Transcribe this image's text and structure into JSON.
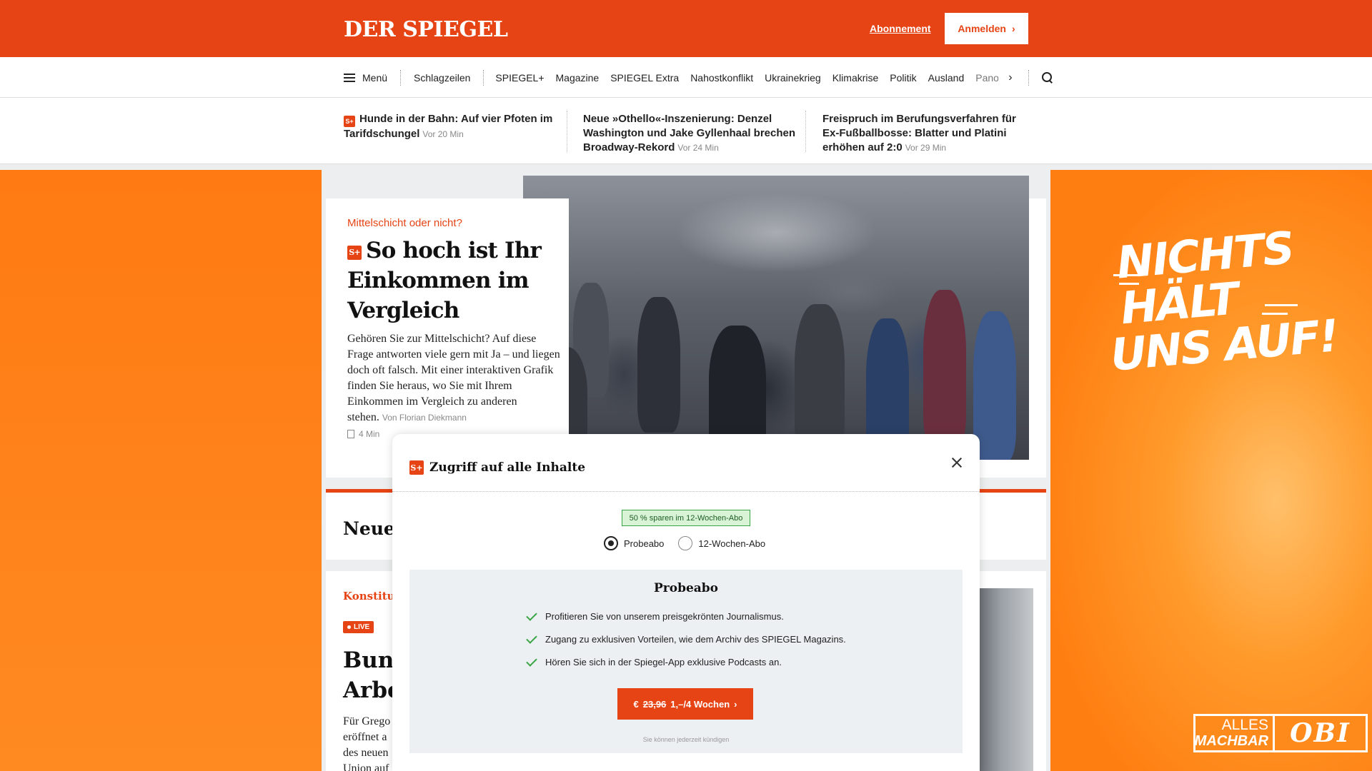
{
  "header": {
    "logo": "DER SPIEGEL",
    "subscription_link": "Abonnement",
    "login_button": "Anmelden",
    "chevron": "›"
  },
  "nav": {
    "menu_label": "Menü",
    "items": [
      "Schlagzeilen",
      "SPIEGEL+",
      "Magazine",
      "SPIEGEL Extra",
      "Nahostkonflikt",
      "Ukrainekrieg",
      "Klimakrise",
      "Politik",
      "Ausland"
    ],
    "overflow_item": "Panora",
    "next_arrow": "›"
  },
  "ticker": [
    {
      "badge": "S+",
      "title": "Hunde in der Bahn: Auf vier Pfoten im Tarifdschungel",
      "time": "Vor 20 Min"
    },
    {
      "badge": "",
      "title": "Neue »Othello«-Inszenierung: Denzel Washington und Jake Gyllenhaal brechen Broadway-Rekord",
      "time": "Vor 24 Min"
    },
    {
      "badge": "",
      "title": "Freispruch im Berufungsverfahren für Ex-Fußballbosse: Blatter und Platini erhöhen auf 2:0",
      "time": "Vor 29 Min"
    }
  ],
  "hero": {
    "kicker": "Mittelschicht oder nicht?",
    "badge": "S+",
    "headline": "So hoch ist Ihr Einkommen im Vergleich",
    "teaser": "Gehören Sie zur Mittelschicht? Auf diese Frage antworten viele gern mit Ja – und liegen doch oft falsch. Mit einer interaktiven Grafik finden Sie heraus, wo Sie mit Ihrem Einkommen im Vergleich zu anderen stehen.",
    "author": "Von Florian Diekmann",
    "read_time": "4 Min"
  },
  "section": {
    "title": "Neuer"
  },
  "news": {
    "kicker": "Konstitu",
    "live_label": "LIVE",
    "title_line1": "Bund",
    "title_line2": "Arbe",
    "teaser_lines": [
      "Für Grego",
      "eröffnet a",
      "des neuen",
      "Union auf"
    ]
  },
  "ad": {
    "slogan_line1": "NICHTS HÄLT",
    "slogan_line2": "UNS AUF!",
    "brand_tagline_1": "ALLES",
    "brand_tagline_2": "MACHBAR",
    "brand": "OBI",
    "colors": {
      "primary": "#ff7a12",
      "brand_orange": "#ff8a1c"
    }
  },
  "modal": {
    "badge": "S+",
    "title": "Zugriff auf alle Inhalte",
    "savings_badge": "50 % sparen im 12-Wochen-Abo",
    "options": [
      {
        "label": "Probeabo",
        "selected": true
      },
      {
        "label": "12-Wochen-Abo",
        "selected": false
      }
    ],
    "offer_title": "Probeabo",
    "benefits": [
      "Profitieren Sie von unserem preisgekrönten Journalismus.",
      "Zugang zu exklusiven Vorteilen, wie dem Archiv des SPIEGEL Magazins.",
      "Hören Sie sich in der Spiegel-App exklusive Podcasts an."
    ],
    "cta_currency": "€",
    "cta_old_price": "23,96",
    "cta_new_price": "1,–/4 Wochen",
    "cta_chevron": "›",
    "cancel_note": "Sie können jederzeit kündigen"
  },
  "colors": {
    "accent": "#e64415",
    "success": "#3aa544"
  }
}
